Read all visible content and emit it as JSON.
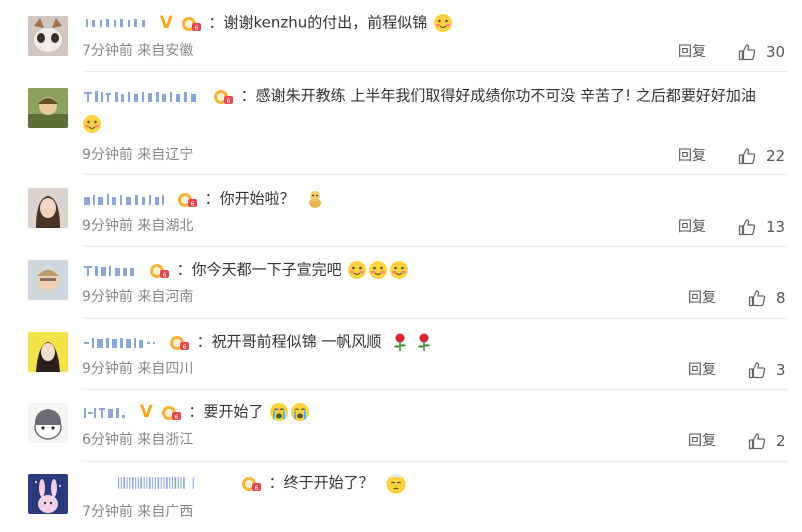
{
  "comments": [
    {
      "text": "：谢谢kenzhu的付出，前程似锦",
      "time": "7分钟前",
      "source": "来自安徽",
      "reply": "回复",
      "likes": "30",
      "verified": true
    },
    {
      "text": "：感谢朱开教练 上半年我们取得好成绩你功不可没 辛苦了! 之后都要好好加油",
      "time": "9分钟前",
      "source": "来自辽宁",
      "reply": "回复",
      "likes": "22",
      "verified": false
    },
    {
      "text": "：你开始啦？",
      "time": "9分钟前",
      "source": "来自湖北",
      "reply": "回复",
      "likes": "13",
      "verified": false
    },
    {
      "text": "：你今天都一下子宣完吧",
      "time": "9分钟前",
      "source": "来自河南",
      "reply": "回复",
      "likes": "8",
      "verified": false
    },
    {
      "text": "：祝开哥前程似锦 一帆风顺",
      "time": "9分钟前",
      "source": "来自四川",
      "reply": "回复",
      "likes": "3",
      "verified": false
    },
    {
      "text": "：要开始了",
      "time": "6分钟前",
      "source": "来自浙江",
      "reply": "回复",
      "likes": "2",
      "verified": true
    },
    {
      "text": "：终于开始了？",
      "time": "7分钟前",
      "source": "来自广西",
      "reply": "",
      "likes": "",
      "verified": false
    }
  ],
  "icons": {
    "verified": "V",
    "like": "thumbs-up-icon",
    "fan_badge": "fan-badge-icon"
  },
  "colors": {
    "verified_badge": "#f5a623",
    "meta_text": "#888888"
  }
}
